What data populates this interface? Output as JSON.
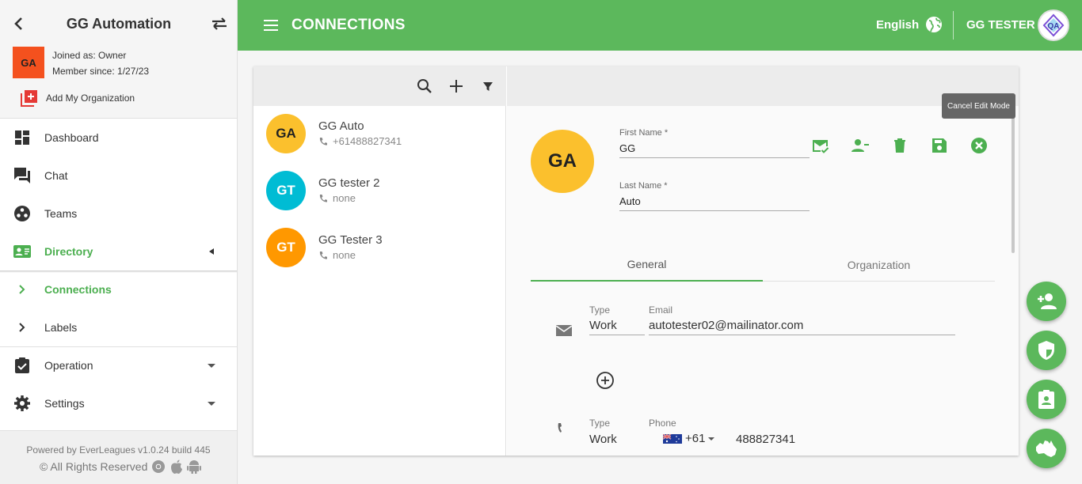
{
  "sidebar": {
    "org_title": "GG Automation",
    "org_avatar": "GA",
    "joined": "Joined as: Owner",
    "member_since": "Member since: 1/27/23",
    "add_org": "Add My Organization",
    "nav": [
      {
        "label": "Dashboard",
        "icon": "dashboard-icon"
      },
      {
        "label": "Chat",
        "icon": "chat-icon"
      },
      {
        "label": "Teams",
        "icon": "teams-icon"
      },
      {
        "label": "Directory",
        "icon": "directory-icon"
      },
      {
        "label": "Connections",
        "icon": "chevron-right-icon"
      },
      {
        "label": "Labels",
        "icon": "chevron-right-icon"
      },
      {
        "label": "Operation",
        "icon": "clipboard-check-icon"
      },
      {
        "label": "Settings",
        "icon": "gear-icon"
      }
    ],
    "footer": {
      "powered": "Powered by EverLeagues v1.0.24 build 445",
      "rights": "© All Rights Reserved"
    }
  },
  "topbar": {
    "title": "CONNECTIONS",
    "language": "English",
    "user_name": "GG TESTER",
    "user_avatar": "QA"
  },
  "contacts": [
    {
      "initials": "GA",
      "name": "GG Auto",
      "phone": "+61488827341",
      "color": "#fbc02d"
    },
    {
      "initials": "GT",
      "name": "GG tester 2",
      "phone": "none",
      "color": "#00bcd4"
    },
    {
      "initials": "GT",
      "name": "GG Tester 3",
      "phone": "none",
      "color": "#ff9800"
    }
  ],
  "detail": {
    "avatar": "GA",
    "first_name_label": "First Name *",
    "first_name": "GG",
    "last_name_label": "Last Name *",
    "last_name": "Auto",
    "tooltip": "Cancel Edit Mode",
    "tabs": [
      "General",
      "Organization"
    ],
    "email": {
      "type_label": "Type",
      "type": "Work",
      "label": "Email",
      "value": "autotester02@mailinator.com"
    },
    "phone": {
      "type_label": "Type",
      "type": "Work",
      "label": "Phone",
      "country_code": "+61",
      "number": "488827341"
    }
  },
  "colors": {
    "accent": "#5cb85c",
    "active": "#4caf50"
  }
}
